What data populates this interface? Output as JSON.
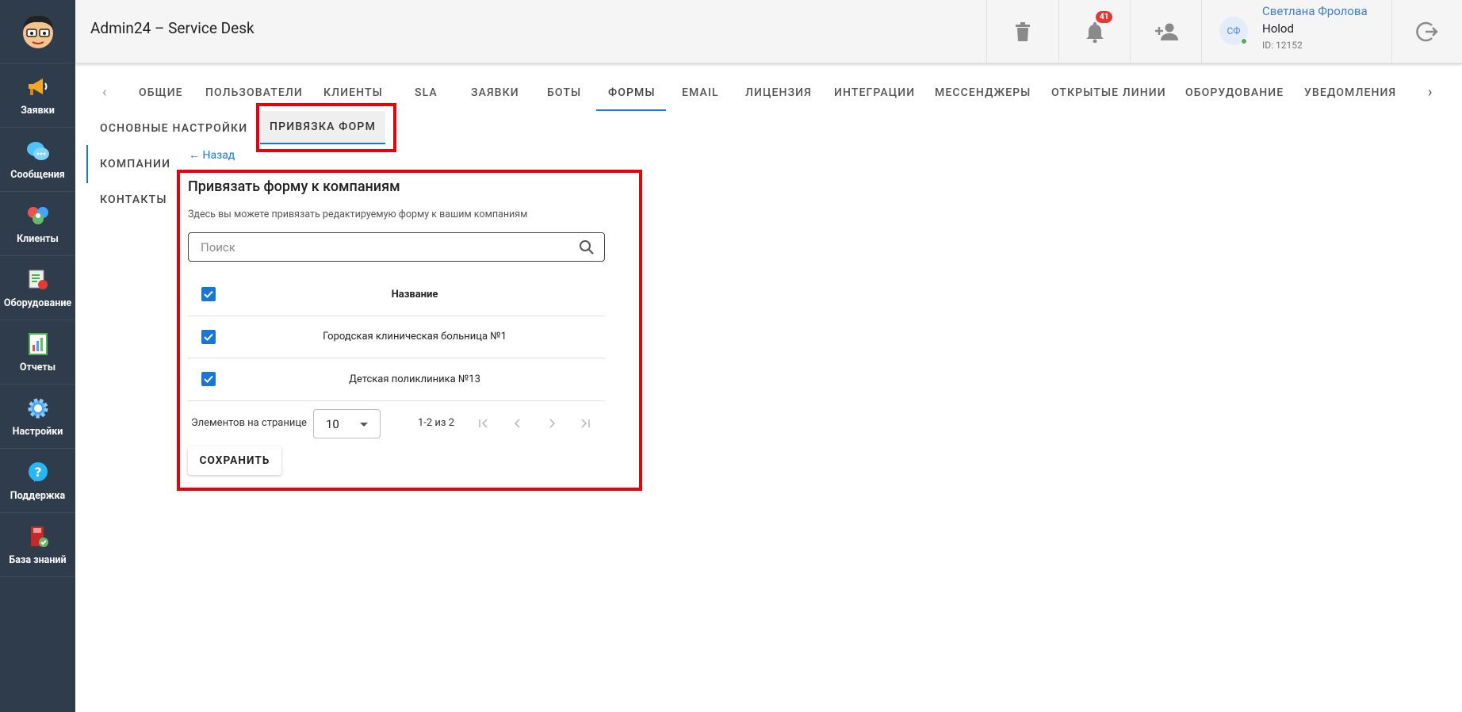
{
  "app": {
    "title": "Admin24 – Service Desk"
  },
  "sidebar": {
    "items": [
      {
        "label": "Заявки",
        "icon": "megaphone-icon"
      },
      {
        "label": "Сообщения",
        "icon": "chat-bubbles-icon"
      },
      {
        "label": "Клиенты",
        "icon": "clients-icon"
      },
      {
        "label": "Оборудование",
        "icon": "equipment-icon"
      },
      {
        "label": "Отчеты",
        "icon": "reports-icon"
      },
      {
        "label": "Настройки",
        "icon": "gear-icon"
      },
      {
        "label": "Поддержка",
        "icon": "help-icon"
      },
      {
        "label": "База знаний",
        "icon": "book-icon"
      }
    ]
  },
  "header": {
    "notifications_count": "41",
    "user": {
      "initials": "СФ",
      "name": "Светлана Фролова",
      "company": "Holod",
      "id_text": "ID: 12152"
    }
  },
  "tabs": {
    "items": [
      "ОБЩИЕ",
      "ПОЛЬЗОВАТЕЛИ",
      "КЛИЕНТЫ",
      "SLA",
      "ЗАЯВКИ",
      "БОТЫ",
      "ФОРМЫ",
      "EMAIL",
      "ЛИЦЕНЗИЯ",
      "ИНТЕГРАЦИИ",
      "МЕССЕНДЖЕРЫ",
      "ОТКРЫТЫЕ ЛИНИИ",
      "ОБОРУДОВАНИЕ",
      "УВЕДОМЛЕНИЯ"
    ],
    "active": "ФОРМЫ"
  },
  "subnav": {
    "main_settings": "ОСНОВНЫЕ НАСТРОЙКИ",
    "form_binding": "ПРИВЯЗКА ФОРМ",
    "companies": "КОМПАНИИ",
    "contacts": "КОНТАКТЫ"
  },
  "panel": {
    "back": "Назад",
    "title": "Привязать форму к компаниям",
    "description": "Здесь вы можете привязать редактируемую форму к вашим компаниям",
    "search_placeholder": "Поиск",
    "column_header": "Название",
    "rows": [
      {
        "name": "Городская клиническая больница №1",
        "checked": true
      },
      {
        "name": "Детская поликлиника №13",
        "checked": true
      }
    ],
    "pager_label": "Элементов на странице",
    "page_size": "10",
    "page_range": "1-2 из 2",
    "save_label": "СОХРАНИТЬ"
  },
  "colors": {
    "accent": "#1976d2",
    "sidebar": "#2f3c4b",
    "highlight": "#e8000b",
    "badge": "#e53935"
  }
}
